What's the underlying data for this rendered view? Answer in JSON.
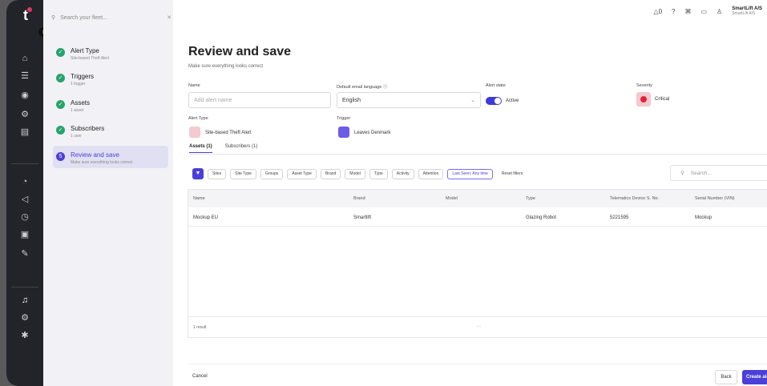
{
  "search": {
    "placeholder": "Search your fleet..."
  },
  "account": {
    "name": "SmartLift A/S",
    "company": "SmartLift A/S"
  },
  "steps": [
    {
      "title": "Alert Type",
      "subtitle": "Site-based Theft Alert"
    },
    {
      "title": "Triggers",
      "subtitle": "1 trigger"
    },
    {
      "title": "Assets",
      "subtitle": "1 asset"
    },
    {
      "title": "Subscribers",
      "subtitle": "1 user"
    },
    {
      "title": "Review and save",
      "subtitle": "Make sure everything looks correct"
    }
  ],
  "page": {
    "title": "Review and save",
    "subtitle": "Make sure everything looks correct"
  },
  "form": {
    "name_label": "Name",
    "name_placeholder": "Add alert name",
    "language_label": "Default email language",
    "language_value": "English",
    "state_label": "Alert state",
    "state_value": "Active",
    "severity_label": "Severity",
    "severity_value": "Critical",
    "alert_type_label": "Alert Type",
    "alert_type_value": "Site-based Theft Alert",
    "trigger_label": "Trigger",
    "trigger_value": "Leaves Denmark"
  },
  "tabs": [
    {
      "label": "Assets (1)"
    },
    {
      "label": "Subscribers (1)"
    }
  ],
  "filters": [
    "Sites",
    "Site Type",
    "Groups",
    "Asset Type",
    "Brand",
    "Model",
    "Type",
    "Activity",
    "Attention",
    "Last Seen: Any time"
  ],
  "reset_filters": "Reset filters",
  "table_search_placeholder": "Search...",
  "columns": [
    "Name",
    "Brand",
    "Model",
    "Type",
    "Telematics Device S. No.",
    "Serial Number (VIN)"
  ],
  "rows": [
    {
      "name": "Mockup EU",
      "brand": "Smartlift",
      "model": "",
      "type": "Glazing Robot",
      "device": "5221595",
      "serial": "Mockup"
    }
  ],
  "result_count": "1 result",
  "pagination": "‹   ›",
  "footer": {
    "cancel": "Cancel",
    "back": "Back",
    "create": "Create alert"
  },
  "colors": {
    "accent": "#4a3fd8",
    "success": "#27a36b",
    "critical": "#e0263c"
  }
}
